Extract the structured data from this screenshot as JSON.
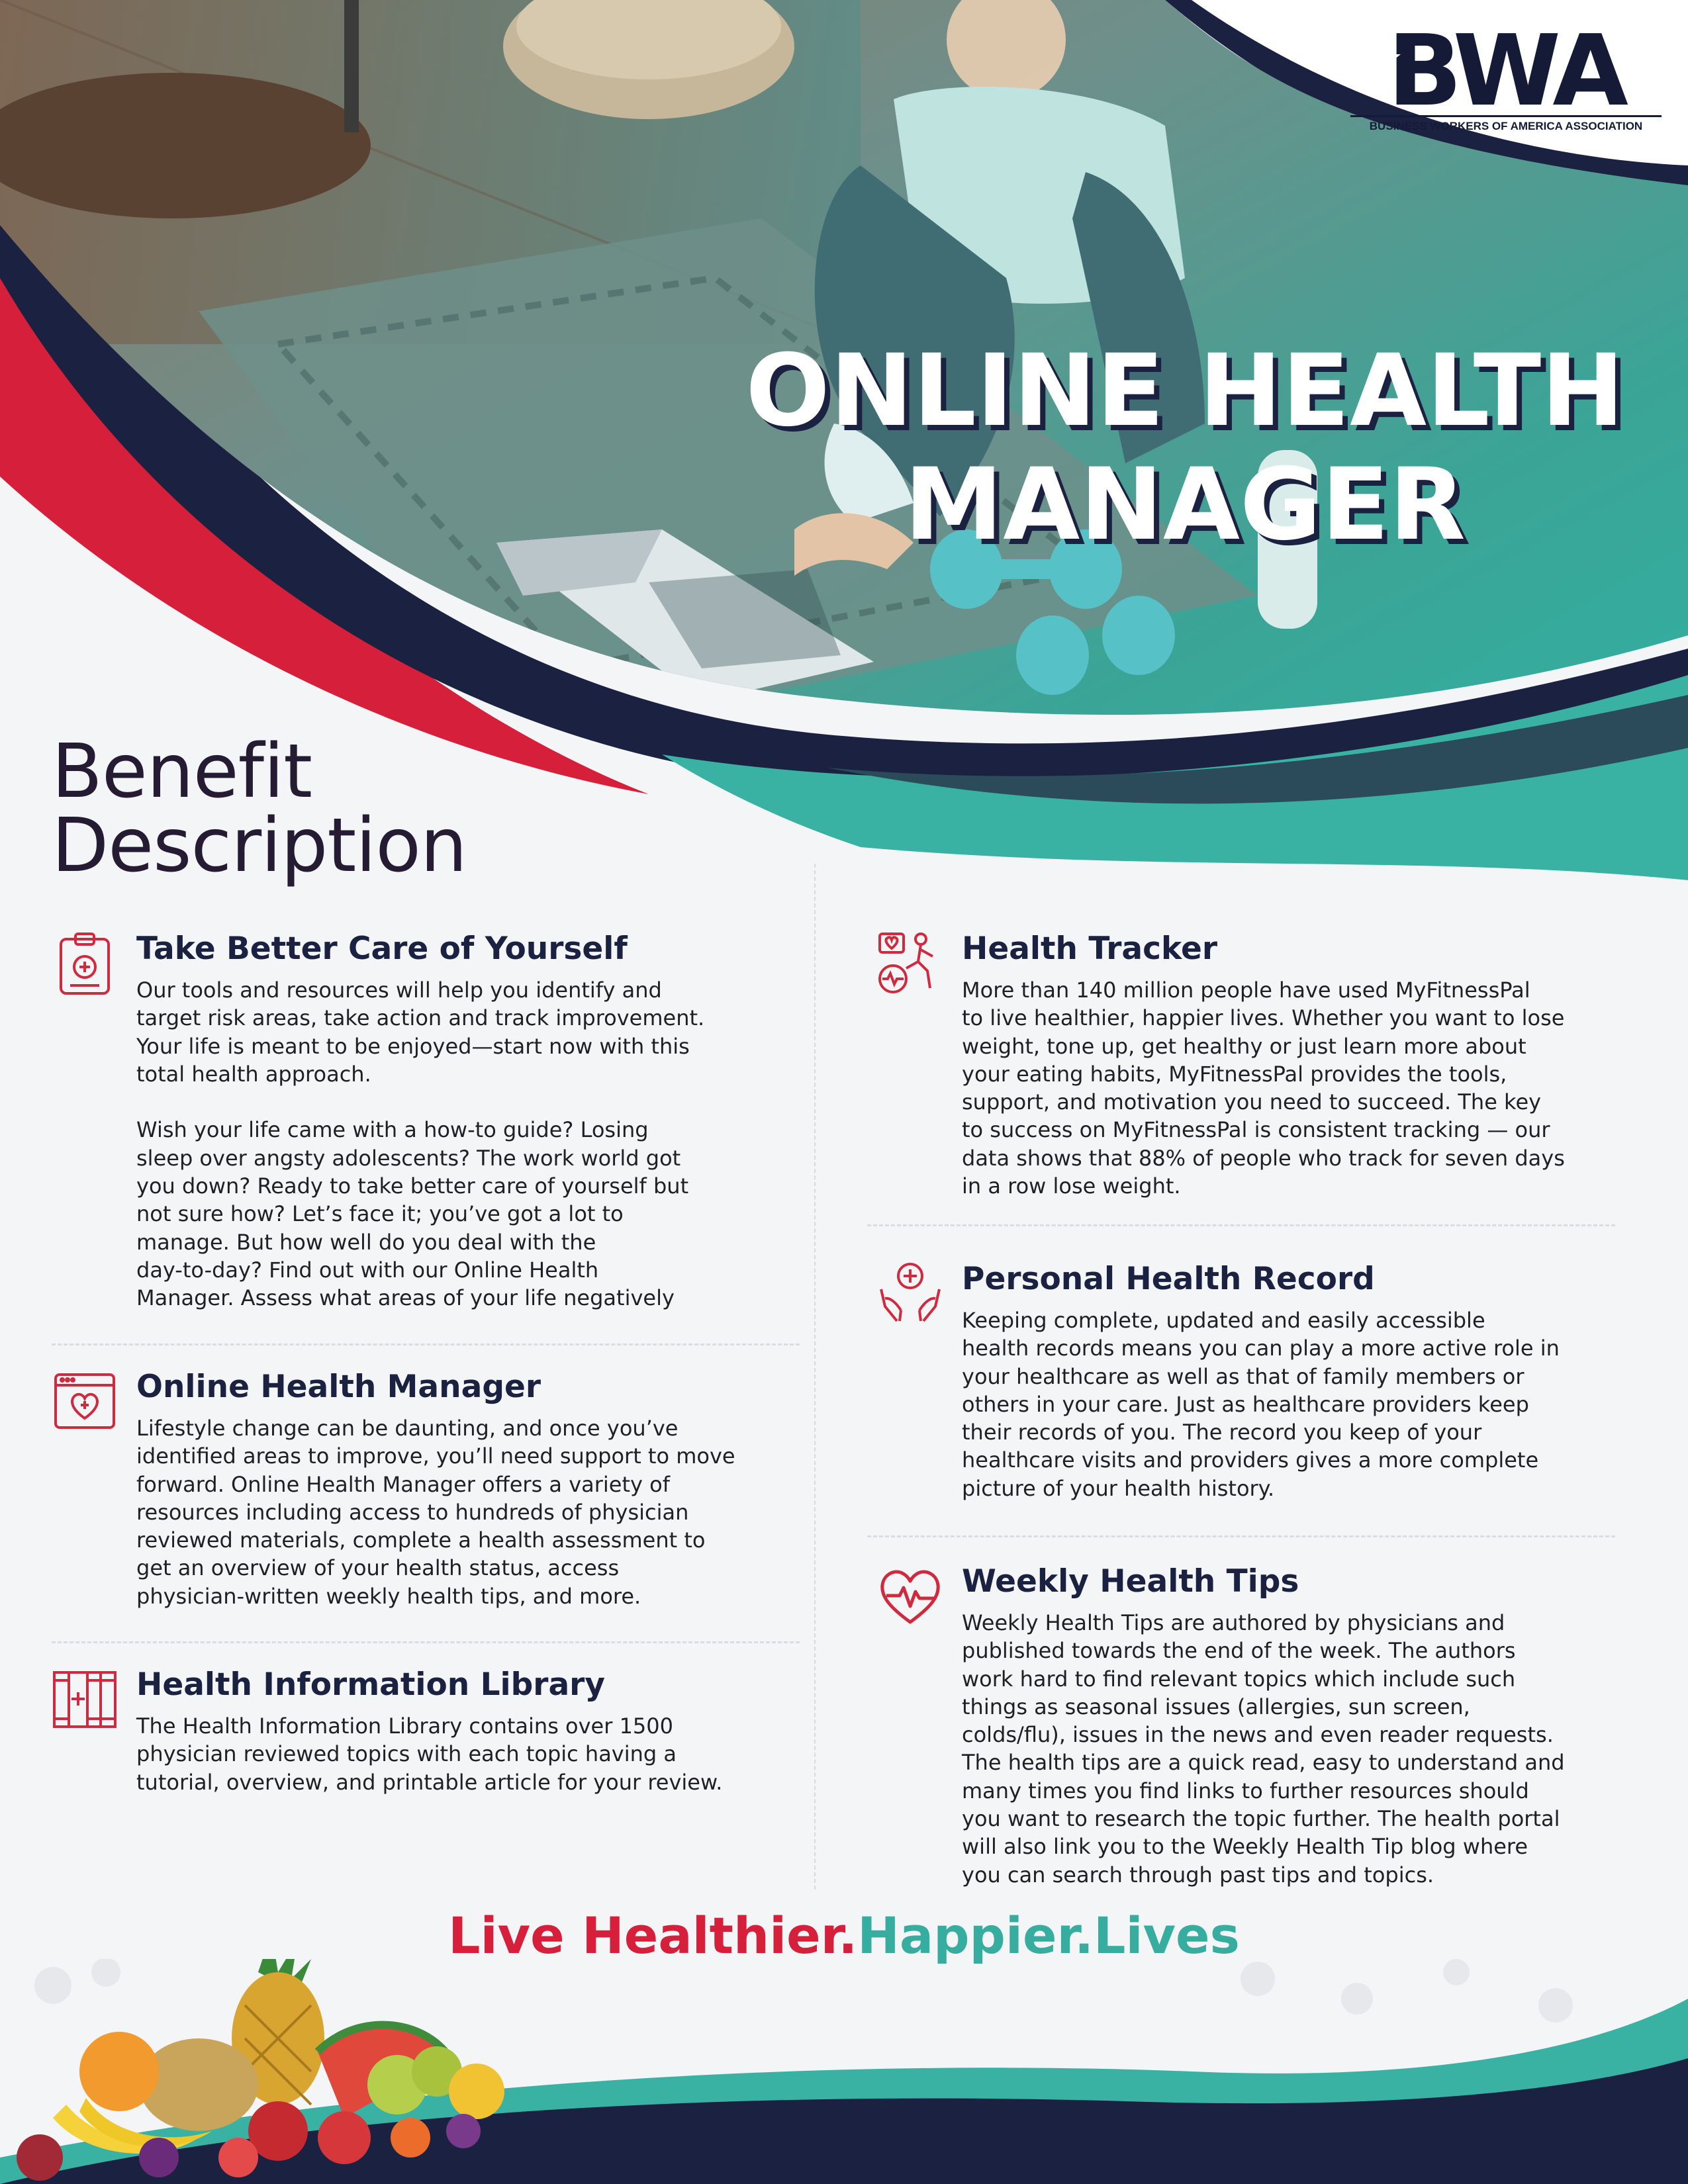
{
  "logo": {
    "brand": "BWA",
    "subtitle": "BUSINESS WORKERS OF AMERICA ASSOCIATION"
  },
  "hero": {
    "title_line1": "ONLINE HEALTH",
    "title_line2": "MANAGER",
    "photo_description_icon": "woman-with-laptop-photo"
  },
  "section": {
    "title_line1": "Benefit",
    "title_line2": "Description"
  },
  "left_column": [
    {
      "icon": "clipboard-plus-icon",
      "heading": "Take Better Care of Yourself",
      "body": "Our tools and resources will help you identify and\ntarget risk areas, take action and track improvement.\nYour life is meant to be enjoyed—start now with this\ntotal health approach.\n\nWish your life came with a how-to guide? Losing\nsleep over angsty adolescents? The work world got\nyou down? Ready to take better care of yourself but\nnot sure how? Let’s face it; you’ve got a lot to\nmanage. But how well do you deal with the\nday-to-day? Find out with our Online Health\nManager. Assess what areas of your life negatively"
    },
    {
      "icon": "browser-heart-icon",
      "heading": "Online Health Manager",
      "body": "Lifestyle change can be daunting, and once you’ve\nidentified areas to improve, you’ll need support to move\nforward. Online Health Manager offers a variety of\nresources including access to hundreds of physician\nreviewed materials, complete a health assessment to\nget an overview of your health status, access\nphysician-written weekly health tips, and more."
    },
    {
      "icon": "books-icon",
      "heading": "Health Information Library",
      "body": "The Health Information Library contains over 1500\nphysician reviewed topics with each topic having a\ntutorial, overview, and printable article for your review."
    }
  ],
  "right_column": [
    {
      "icon": "fitness-tracker-icon",
      "heading": "Health Tracker",
      "body": "More than 140 million people have used MyFitnessPal\nto live healthier, happier lives. Whether you want to lose\nweight, tone up, get healthy or just learn more about\nyour eating habits, MyFitnessPal provides the tools,\nsupport, and motivation you need to succeed. The key\nto success on MyFitnessPal is consistent tracking — our\ndata shows that 88% of people who track for seven days\nin a row lose weight."
    },
    {
      "icon": "hands-plus-icon",
      "heading": "Personal Health Record",
      "body": "Keeping complete, updated and easily accessible\nhealth records means you can play a more active role in\nyour healthcare as well as that of family members or\nothers in your care. Just as healthcare providers keep\ntheir records of you. The record you keep of your\nhealthcare visits and providers gives a more complete\npicture of your health history."
    },
    {
      "icon": "heartbeat-icon",
      "heading": "Weekly Health Tips",
      "body": "Weekly Health Tips are authored by physicians and\npublished towards the end of the week. The authors\nwork hard to find relevant topics which include such\nthings as seasonal issues (allergies, sun screen,\ncolds/flu), issues in the news and even reader requests.\nThe health tips are a quick read, easy to understand and\nmany times you find links to further resources should\nyou want to research the topic further. The health portal\nwill also link you to the Weekly Health Tip blog where\nyou can search through past tips and topics."
    }
  ],
  "tagline": {
    "part1": "Live Healthier.",
    "part2": "Happier.Lives"
  },
  "colors": {
    "navy": "#1b2140",
    "teal": "#37ad9f",
    "red": "#d61f3a",
    "icon_red": "#d02a3e",
    "background": "#f4f5f7"
  }
}
